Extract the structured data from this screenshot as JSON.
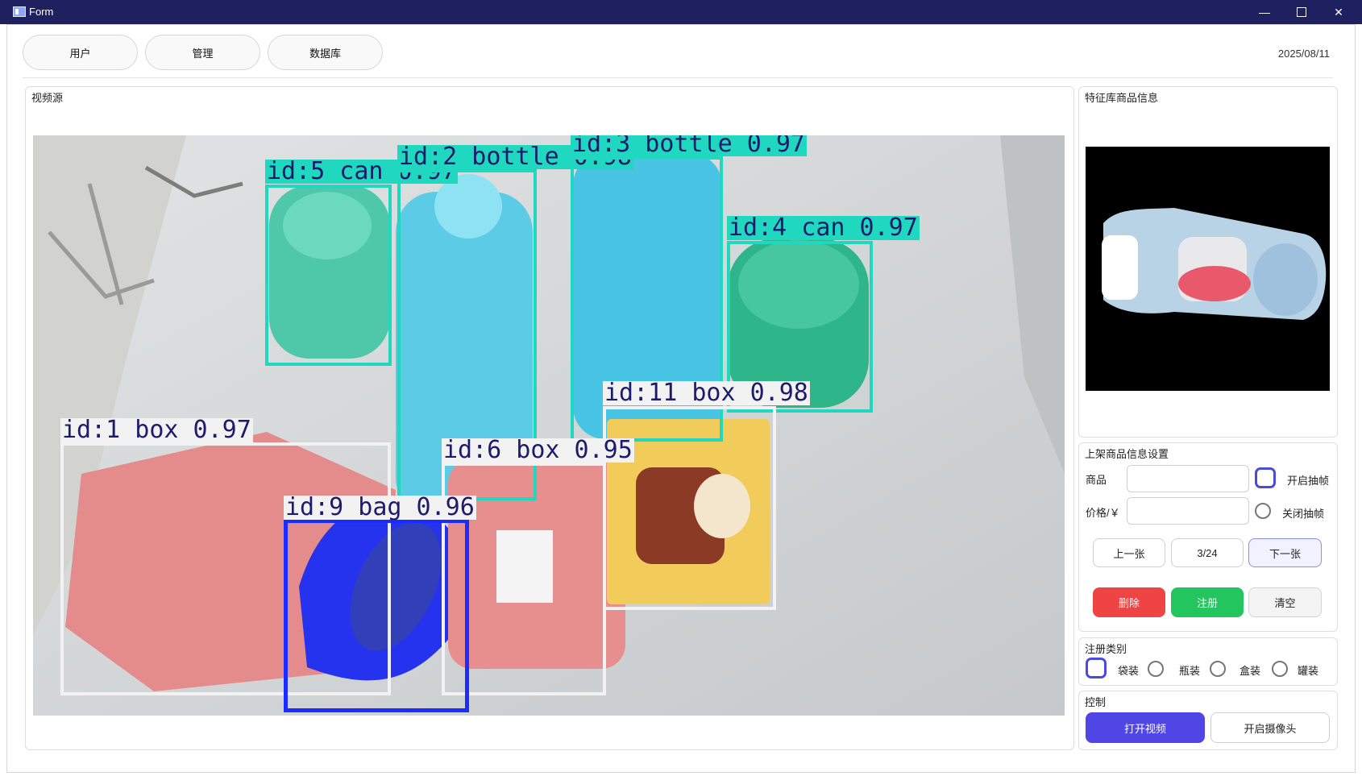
{
  "window": {
    "title": "Form"
  },
  "tabs": [
    {
      "label": "用户"
    },
    {
      "label": "管理"
    },
    {
      "label": "数据库"
    }
  ],
  "date": "2025/08/11",
  "video_panel": {
    "title": "视频源"
  },
  "detections": [
    {
      "label": "id:5 can 0.97",
      "color": "#20d8c0"
    },
    {
      "label": "id:2 bottle 0.98",
      "color": "#20d8c0"
    },
    {
      "label": "id:3 bottle 0.97",
      "color": "#20d8c0"
    },
    {
      "label": "id:4 can 0.97",
      "color": "#20d8c0"
    },
    {
      "label": "id:11 box 0.98",
      "color": "#f2f2f2"
    },
    {
      "label": "id:1 box 0.97",
      "color": "#f2f2f2"
    },
    {
      "label": "id:6 box 0.95",
      "color": "#f2f2f2"
    },
    {
      "label": "id:9 bag 0.96",
      "color": "#1a2cff"
    }
  ],
  "feature_panel": {
    "title": "特征库商品信息"
  },
  "shelf_panel": {
    "title": "上架商品信息设置",
    "product_label": "商品",
    "product_value": "",
    "price_label": "价格/￥",
    "price_value": "",
    "frame_on_label": "开启抽帧",
    "frame_off_label": "关闭抽帧",
    "prev_label": "上一张",
    "page_indicator": "3/24",
    "next_label": "下一张",
    "delete_label": "删除",
    "register_label": "注册",
    "clear_label": "清空"
  },
  "category_panel": {
    "title": "注册类别",
    "options": [
      {
        "label": "袋装",
        "checked": true
      },
      {
        "label": "瓶装",
        "checked": false
      },
      {
        "label": "盒装",
        "checked": false
      },
      {
        "label": "罐装",
        "checked": false
      }
    ]
  },
  "control_panel": {
    "title": "控制",
    "open_video_label": "打开视频",
    "open_camera_label": "开启摄像头"
  },
  "colors": {
    "titlebar": "#1f2060",
    "accent": "#4f46e5",
    "delete": "#ef4444",
    "register": "#22c55e"
  }
}
